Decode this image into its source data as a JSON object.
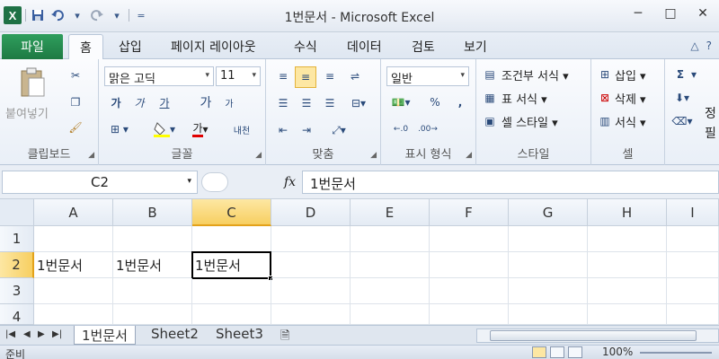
{
  "app": {
    "title": "1번문서 - Microsoft Excel",
    "logo": "X"
  },
  "qat": {
    "undo_arrow": "▾",
    "qat_more": "="
  },
  "window": {
    "minimize": "─",
    "restore": "□",
    "close": "✕"
  },
  "tabs": {
    "file": "파일",
    "items": [
      "홈",
      "삽입",
      "페이지 레이아웃",
      "수식",
      "데이터",
      "검토",
      "보기"
    ]
  },
  "ribbon": {
    "clipboard": {
      "label": "클립보드",
      "paste": "붙여넣기"
    },
    "font": {
      "label": "글꼴",
      "family": "맑은 고딕",
      "size": "11",
      "bold": "가",
      "italic": "가",
      "underline": "가",
      "grow": "가",
      "shrink": "가",
      "fontcolor": "가",
      "phonetic": "내천"
    },
    "alignment": {
      "label": "맞춤"
    },
    "number": {
      "label": "표시 형식",
      "format": "일반",
      "percent": "%",
      "comma": ","
    },
    "styles": {
      "label": "스타일",
      "conditional": "조건부 서식",
      "table": "표 서식",
      "cell": "셀 스타일"
    },
    "cells": {
      "label": "셀",
      "insert": "삽입",
      "delete": "삭제",
      "format": "서식"
    },
    "editing": {
      "sigma": "Σ",
      "partial1": "정",
      "partial2": "필"
    }
  },
  "formula_bar": {
    "name_box": "C2",
    "fx": "fx",
    "content": "1번문서"
  },
  "grid": {
    "columns": [
      "A",
      "B",
      "C",
      "D",
      "E",
      "F",
      "G",
      "H",
      "I"
    ],
    "rows": [
      "1",
      "2",
      "3",
      "4"
    ],
    "cells": {
      "A2": "1번문서",
      "B2": "1번문서",
      "C2": "1번문서"
    },
    "selected_cell": "C2"
  },
  "sheets": {
    "tabs": [
      "1번문서",
      "Sheet2",
      "Sheet3"
    ],
    "active": "1번문서"
  },
  "status": {
    "text": "준비",
    "zoom": "100%"
  },
  "colors": {
    "file_tab": "#1d7a43",
    "selection": "#f7cf61"
  }
}
